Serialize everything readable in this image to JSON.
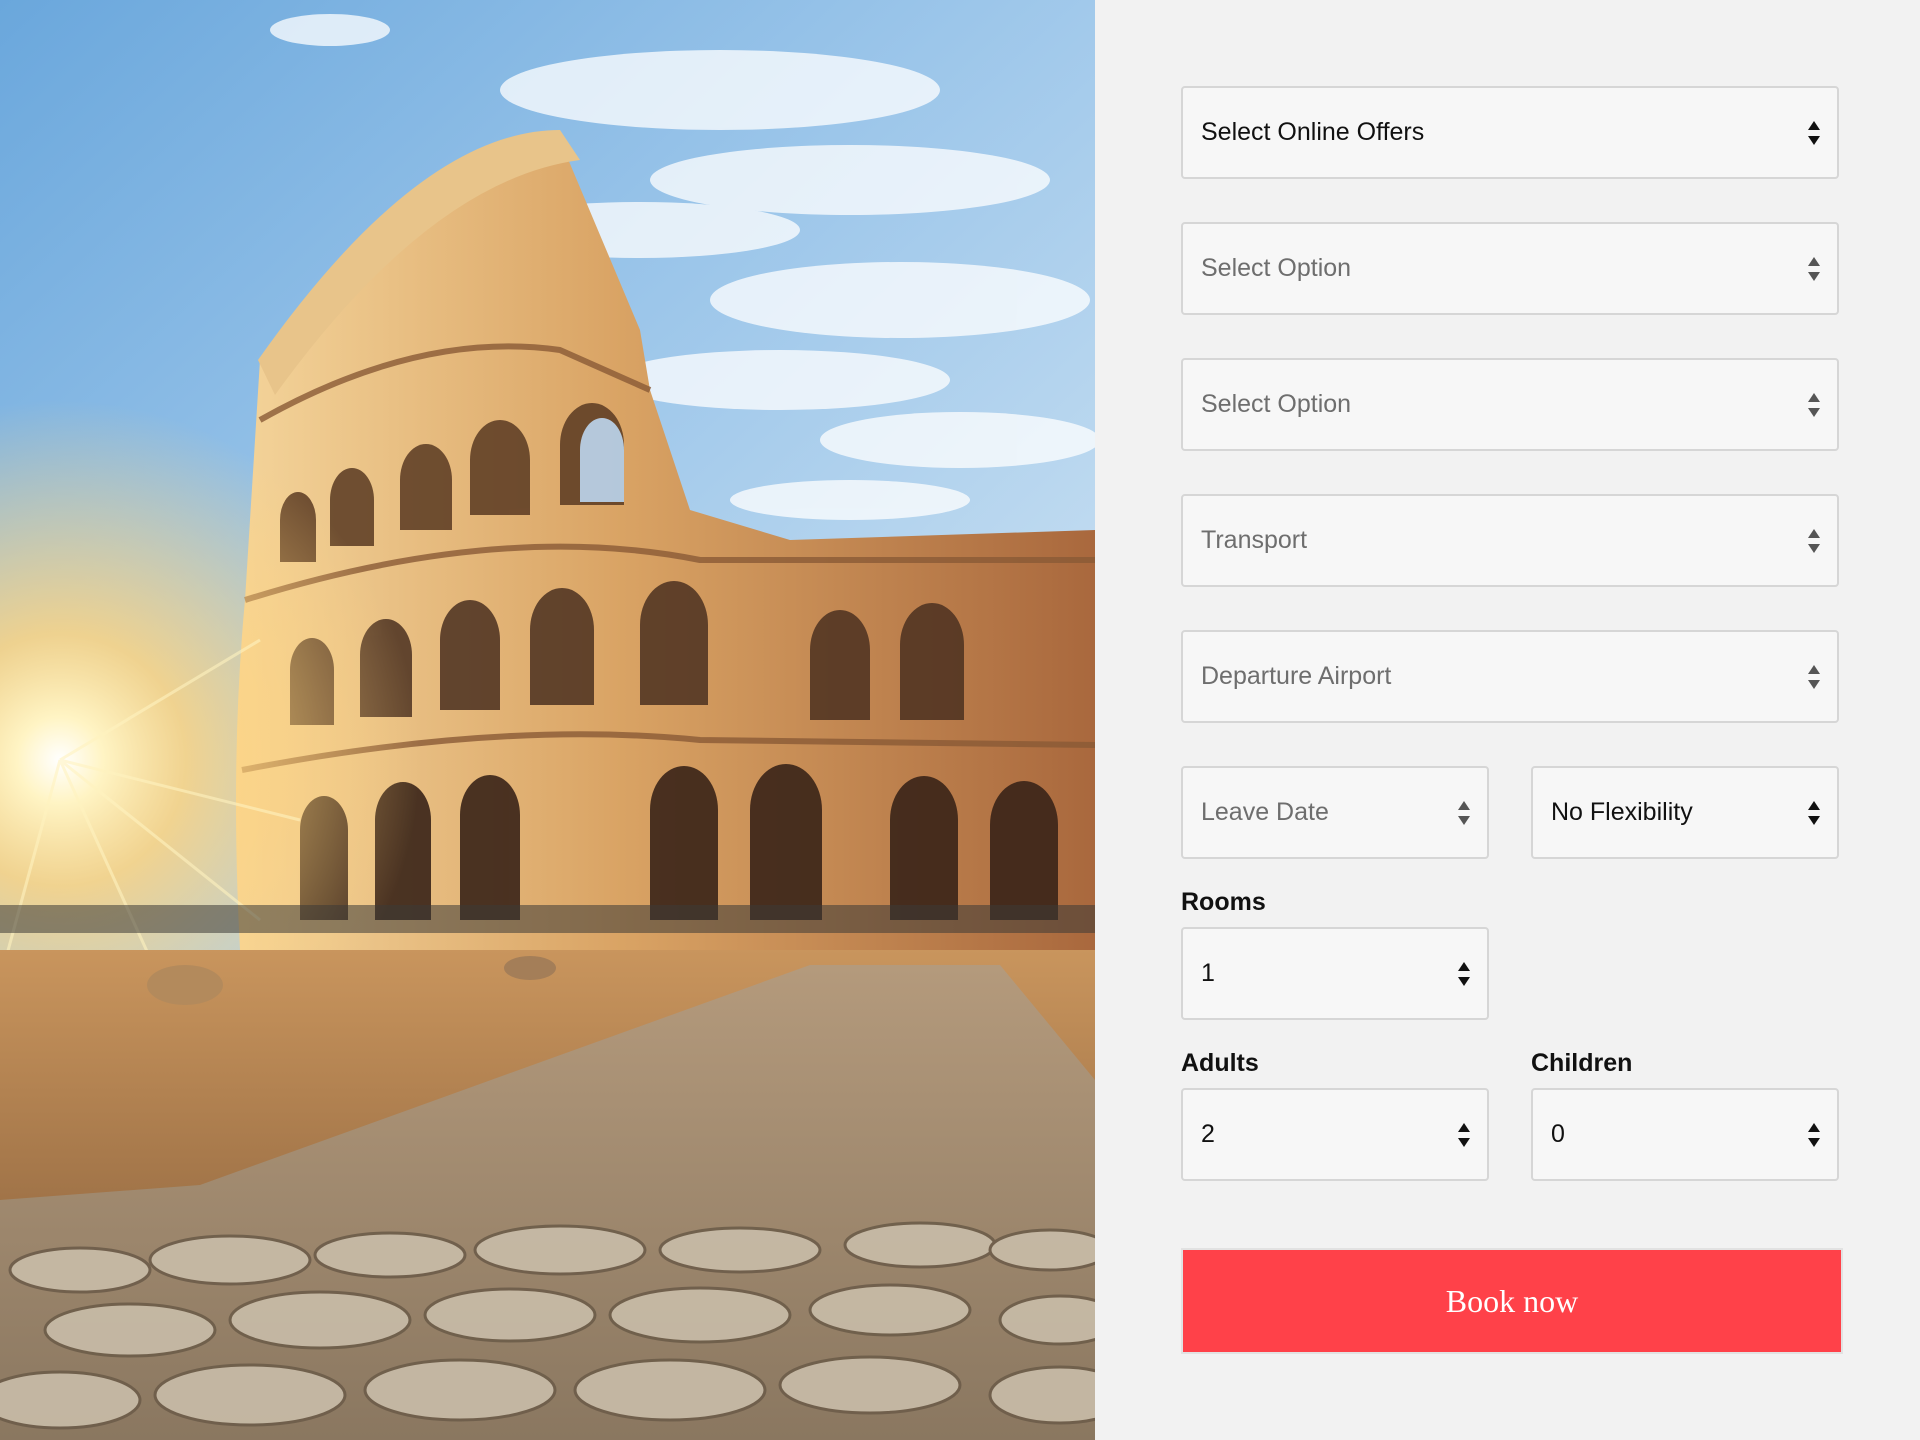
{
  "form": {
    "online_offers": {
      "value": "Select Online Offers"
    },
    "option_one": {
      "placeholder": "Select Option"
    },
    "option_two": {
      "placeholder": "Select Option"
    },
    "transport": {
      "placeholder": "Transport"
    },
    "departure_airport": {
      "placeholder": "Departure Airport"
    },
    "leave_date": {
      "placeholder": "Leave Date"
    },
    "flexibility": {
      "value": "No Flexibility"
    },
    "rooms": {
      "label": "Rooms",
      "value": "1"
    },
    "adults": {
      "label": "Adults",
      "value": "2"
    },
    "children": {
      "label": "Children",
      "value": "0"
    },
    "submit_label": "Book now"
  },
  "colors": {
    "accent": "#ff4149",
    "panel_background": "#f2f2f2",
    "field_background": "#f7f7f7",
    "field_border": "#d6d6d6"
  },
  "icons": {
    "select_arrows": "up-down-arrows-icon"
  }
}
